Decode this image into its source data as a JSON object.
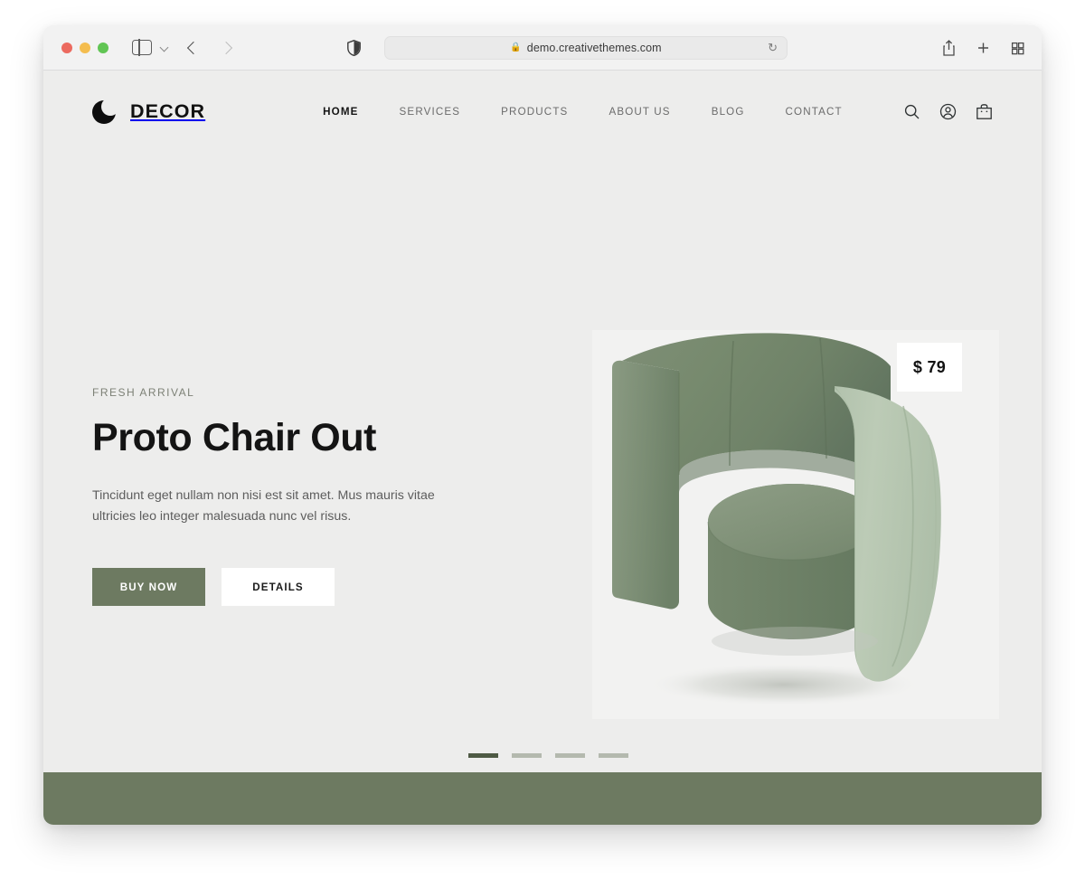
{
  "browser": {
    "traffic_lights": [
      "close",
      "minimize",
      "zoom"
    ],
    "sidebar_toggle": "sidebar-toggle",
    "back_label": "Back",
    "forward_label": "Forward",
    "shield_label": "Privacy Report",
    "url": "demo.creativethemes.com",
    "lock_glyph": "🔒",
    "reload_glyph": "↻",
    "actions": [
      "share",
      "new-tab",
      "tab-overview"
    ]
  },
  "site": {
    "brand": {
      "name": "DECOR"
    },
    "nav": [
      {
        "label": "HOME",
        "active": true
      },
      {
        "label": "SERVICES",
        "active": false
      },
      {
        "label": "PRODUCTS",
        "active": false
      },
      {
        "label": "ABOUT US",
        "active": false
      },
      {
        "label": "BLOG",
        "active": false
      },
      {
        "label": "CONTACT",
        "active": false
      }
    ],
    "header_actions": [
      "search",
      "account",
      "cart"
    ]
  },
  "hero": {
    "eyebrow": "FRESH ARRIVAL",
    "title": "Proto Chair Out",
    "description": "Tincidunt eget nullam non nisi est sit amet. Mus mauris vitae ultricies leo integer malesuada nunc vel risus.",
    "primary_button": "BUY NOW",
    "secondary_button": "DETAILS",
    "price": "$ 79",
    "slides": [
      {
        "index": 1,
        "active": true
      },
      {
        "index": 2,
        "active": false
      },
      {
        "index": 3,
        "active": false
      },
      {
        "index": 4,
        "active": false
      }
    ]
  },
  "colors": {
    "accent_green": "#6d7a61",
    "accent_green_dark": "#4e5a44",
    "page_background": "#ededec",
    "text_dark": "#141414",
    "text_muted": "#5d5d5d"
  }
}
